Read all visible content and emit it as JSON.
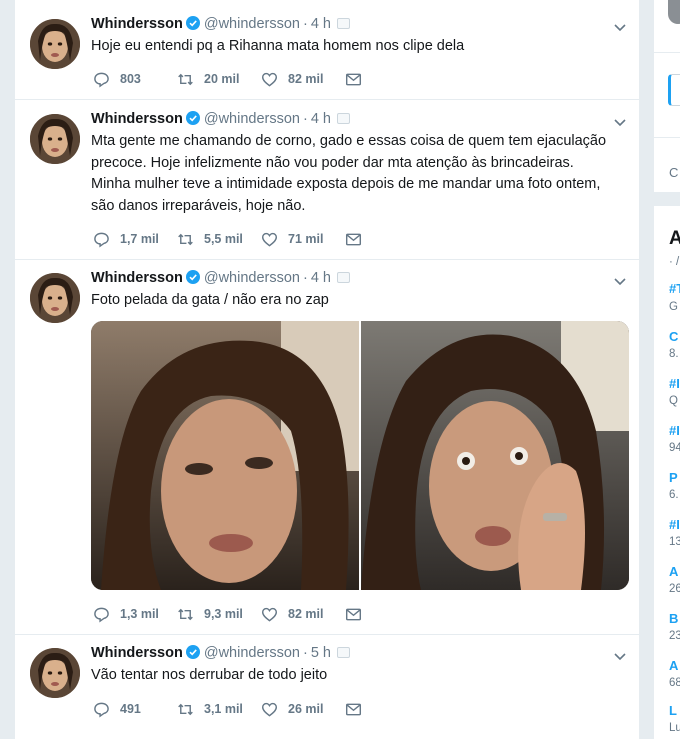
{
  "tweets": [
    {
      "name": "Whindersson",
      "handle": "@whindersson",
      "time": "4 h",
      "text": [
        "Hoje eu entendi pq a Rihanna mata homem nos clipe dela"
      ],
      "replies": "803",
      "retweets": "20 mil",
      "likes": "82 mil"
    },
    {
      "name": "Whindersson",
      "handle": "@whindersson",
      "time": "4 h",
      "text": [
        "Mta gente me chamando de corno, gado e essas coisa de quem tem ejaculação",
        "precoce. Hoje infelizmente não vou poder dar mta atenção às brincadeiras.",
        "Minha mulher teve a intimidade exposta depois de me mandar uma foto ontem,",
        "são danos irreparáveis, hoje não."
      ],
      "replies": "1,7 mil",
      "retweets": "5,5 mil",
      "likes": "71 mil"
    },
    {
      "name": "Whindersson",
      "handle": "@whindersson",
      "time": "4 h",
      "text": [
        "Foto pelada da gata / não era no zap"
      ],
      "replies": "1,3 mil",
      "retweets": "9,3 mil",
      "likes": "82 mil"
    },
    {
      "name": "Whindersson",
      "handle": "@whindersson",
      "time": "5 h",
      "text": [
        "Vão tentar nos derrubar de todo jeito"
      ],
      "replies": "491",
      "retweets": "3,1 mil",
      "likes": "26 mil"
    }
  ],
  "sidebar": {
    "card1_text": "C",
    "trends_title": "A",
    "trends_sub": "· /",
    "trends": [
      {
        "name": "#T",
        "sub": "G"
      },
      {
        "name": "C",
        "sub": "8."
      },
      {
        "name": "#I",
        "sub": "Q"
      },
      {
        "name": "#I",
        "sub": "94"
      },
      {
        "name": "P",
        "sub": "6."
      },
      {
        "name": "#I",
        "sub": "13"
      },
      {
        "name": "A",
        "sub": "26"
      },
      {
        "name": "B",
        "sub": "23"
      },
      {
        "name": "A",
        "sub": "68"
      },
      {
        "name": "L",
        "sub": "Lu"
      }
    ]
  },
  "colors": {
    "blue": "#1da1f2",
    "gray": "#657786",
    "border": "#e6ecf0"
  }
}
